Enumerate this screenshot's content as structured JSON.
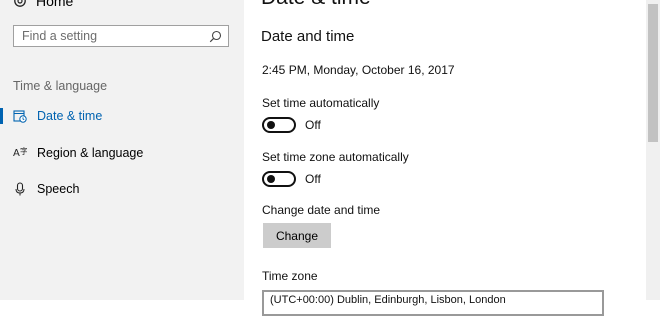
{
  "sidebar": {
    "home_label": "Home",
    "search_placeholder": "Find a setting",
    "group_label": "Time & language",
    "items": [
      {
        "label": "Date & time",
        "icon": "calendar-clock-icon",
        "active": true
      },
      {
        "label": "Region & language",
        "icon": "language-icon",
        "active": false
      },
      {
        "label": "Speech",
        "icon": "microphone-icon",
        "active": false
      }
    ]
  },
  "main": {
    "page_title": "Date & time",
    "section_title": "Date and time",
    "current_datetime": "2:45 PM, Monday, October 16, 2017",
    "set_time_auto": {
      "label": "Set time automatically",
      "state": "Off"
    },
    "set_timezone_auto": {
      "label": "Set time zone automatically",
      "state": "Off"
    },
    "change_label": "Change date and time",
    "change_button": "Change",
    "timezone_label": "Time zone",
    "timezone_value": "(UTC+00:00) Dublin, Edinburgh, Lisbon, London"
  },
  "colors": {
    "accent": "#0063b1",
    "sidebar_bg": "#f2f2f2",
    "button_bg": "#cccccc"
  }
}
